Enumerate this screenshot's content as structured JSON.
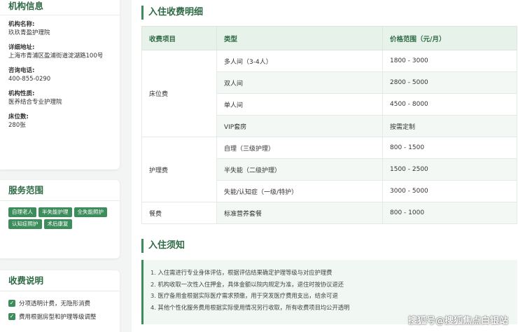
{
  "institution": {
    "title": "机构信息",
    "fields": [
      {
        "label": "机构名称:",
        "value": "玖玖青盈护理院"
      },
      {
        "label": "详细地址:",
        "value": "上海市青浦区盈浦街道淀湖路100号"
      },
      {
        "label": "咨询电话:",
        "value": "400-855-0290"
      },
      {
        "label": "机构性质:",
        "value": "医养结合专业护理院"
      },
      {
        "label": "床位数:",
        "value": "280张"
      }
    ]
  },
  "services": {
    "title": "服务范围",
    "tags": [
      "自理老人",
      "半失能护理",
      "全失能照护",
      "认知症照护",
      "术后康复"
    ]
  },
  "fee_notes": {
    "title": "收费说明",
    "items": [
      "分项透明计费，无隐形消费",
      "费用根据房型和护理等级调整"
    ]
  },
  "fees_section": {
    "title": "入住收费明细",
    "headers": [
      "收费项目",
      "类型",
      "价格范围（元/月）"
    ],
    "groups": [
      {
        "category": "床位费",
        "rows": [
          {
            "type": "多人间（3-4人）",
            "price": "1800 - 3000"
          },
          {
            "type": "双人间",
            "price": "2800 - 5000"
          },
          {
            "type": "单人间",
            "price": "4500 - 8000"
          },
          {
            "type": "VIP套房",
            "price": "按需定制"
          }
        ]
      },
      {
        "category": "护理费",
        "rows": [
          {
            "type": "自理（三级护理）",
            "price": "800 - 1500"
          },
          {
            "type": "半失能（二级护理）",
            "price": "1500 - 2500"
          },
          {
            "type": "失能/认知症（一级/特护）",
            "price": "3000 - 5000"
          }
        ]
      },
      {
        "category": "餐费",
        "rows": [
          {
            "type": "标准营养套餐",
            "price": "800 - 1000"
          }
        ]
      }
    ]
  },
  "notice_section": {
    "title": "入住须知",
    "items": [
      "1. 入住需进行专业身体评估，根据评估结果确定护理等级与对应护理费",
      "2. 机构收取一次性入住押金，具体金额以院内规定为准，退住时按协议退还",
      "3. 医疗备用金根据实际医疗需求预缴，用于突发医疗费用支出，结余可退",
      "4. 其他个性化服务费用根据实际使用情况另行收取，所有收费项目均公开透明"
    ]
  },
  "watermark": "搜狐号@搜狐焦点白银站",
  "colors": {
    "accent": "#3c8c5c",
    "header_bg": "#e7f3ea",
    "title": "#2e6a45"
  },
  "icons": [
    "check-icon"
  ]
}
